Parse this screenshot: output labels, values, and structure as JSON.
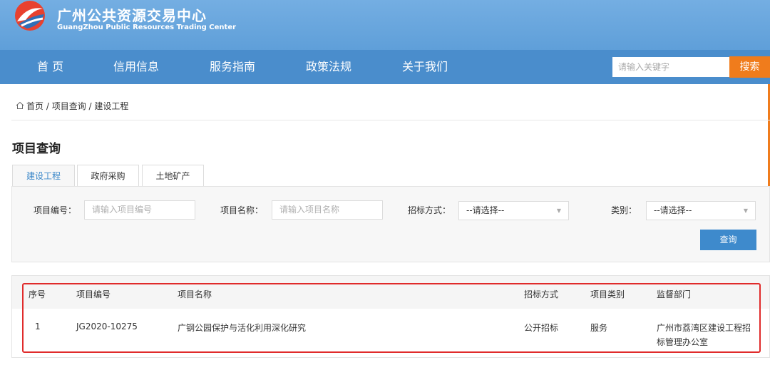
{
  "header": {
    "title": "广州公共资源交易中心",
    "subtitle": "GuangZhou Public Resources Trading Center"
  },
  "nav": {
    "items": [
      "首 页",
      "信用信息",
      "服务指南",
      "政策法规",
      "关于我们"
    ],
    "search_placeholder": "请输入关键字",
    "search_button": "搜索"
  },
  "breadcrumb": {
    "home": "首页",
    "sep1": " / ",
    "level2": "项目查询",
    "sep2": " / ",
    "current": "建设工程"
  },
  "page_title": "项目查询",
  "tabs": [
    "建设工程",
    "政府采购",
    "土地矿产"
  ],
  "active_tab": "建设工程",
  "filters": {
    "project_no_label": "项目编号：",
    "project_no_placeholder": "请输入项目编号",
    "project_name_label": "项目名称：",
    "project_name_placeholder": "请输入项目名称",
    "bid_method_label": "招标方式：",
    "bid_method_value": "--请选择--",
    "category_label": "类别：",
    "category_value": "--请选择--",
    "query_button": "查询"
  },
  "table": {
    "columns": [
      "序号",
      "项目编号",
      "项目名称",
      "招标方式",
      "项目类别",
      "监督部门"
    ],
    "rows": [
      {
        "index": "1",
        "project_no": "JG2020-10275",
        "project_name": "广钢公园保护与活化利用深化研究",
        "bid_method": "公开招标",
        "category": "服务",
        "department_line1": "广州市荔湾区建设工程招",
        "department_line2": "标管理办公室"
      }
    ]
  },
  "colors": {
    "header_bg": "#6aa7de",
    "nav_bg": "#4a8dcc",
    "search_button": "#f07c1c",
    "query_button": "#3e8acc",
    "highlight": "#e02b2b",
    "active_tab_text": "#3a87c9"
  },
  "icons": {
    "logo": "gz-public-resources-logo",
    "home": "home-icon",
    "dropdown": "chevron-down-icon"
  }
}
